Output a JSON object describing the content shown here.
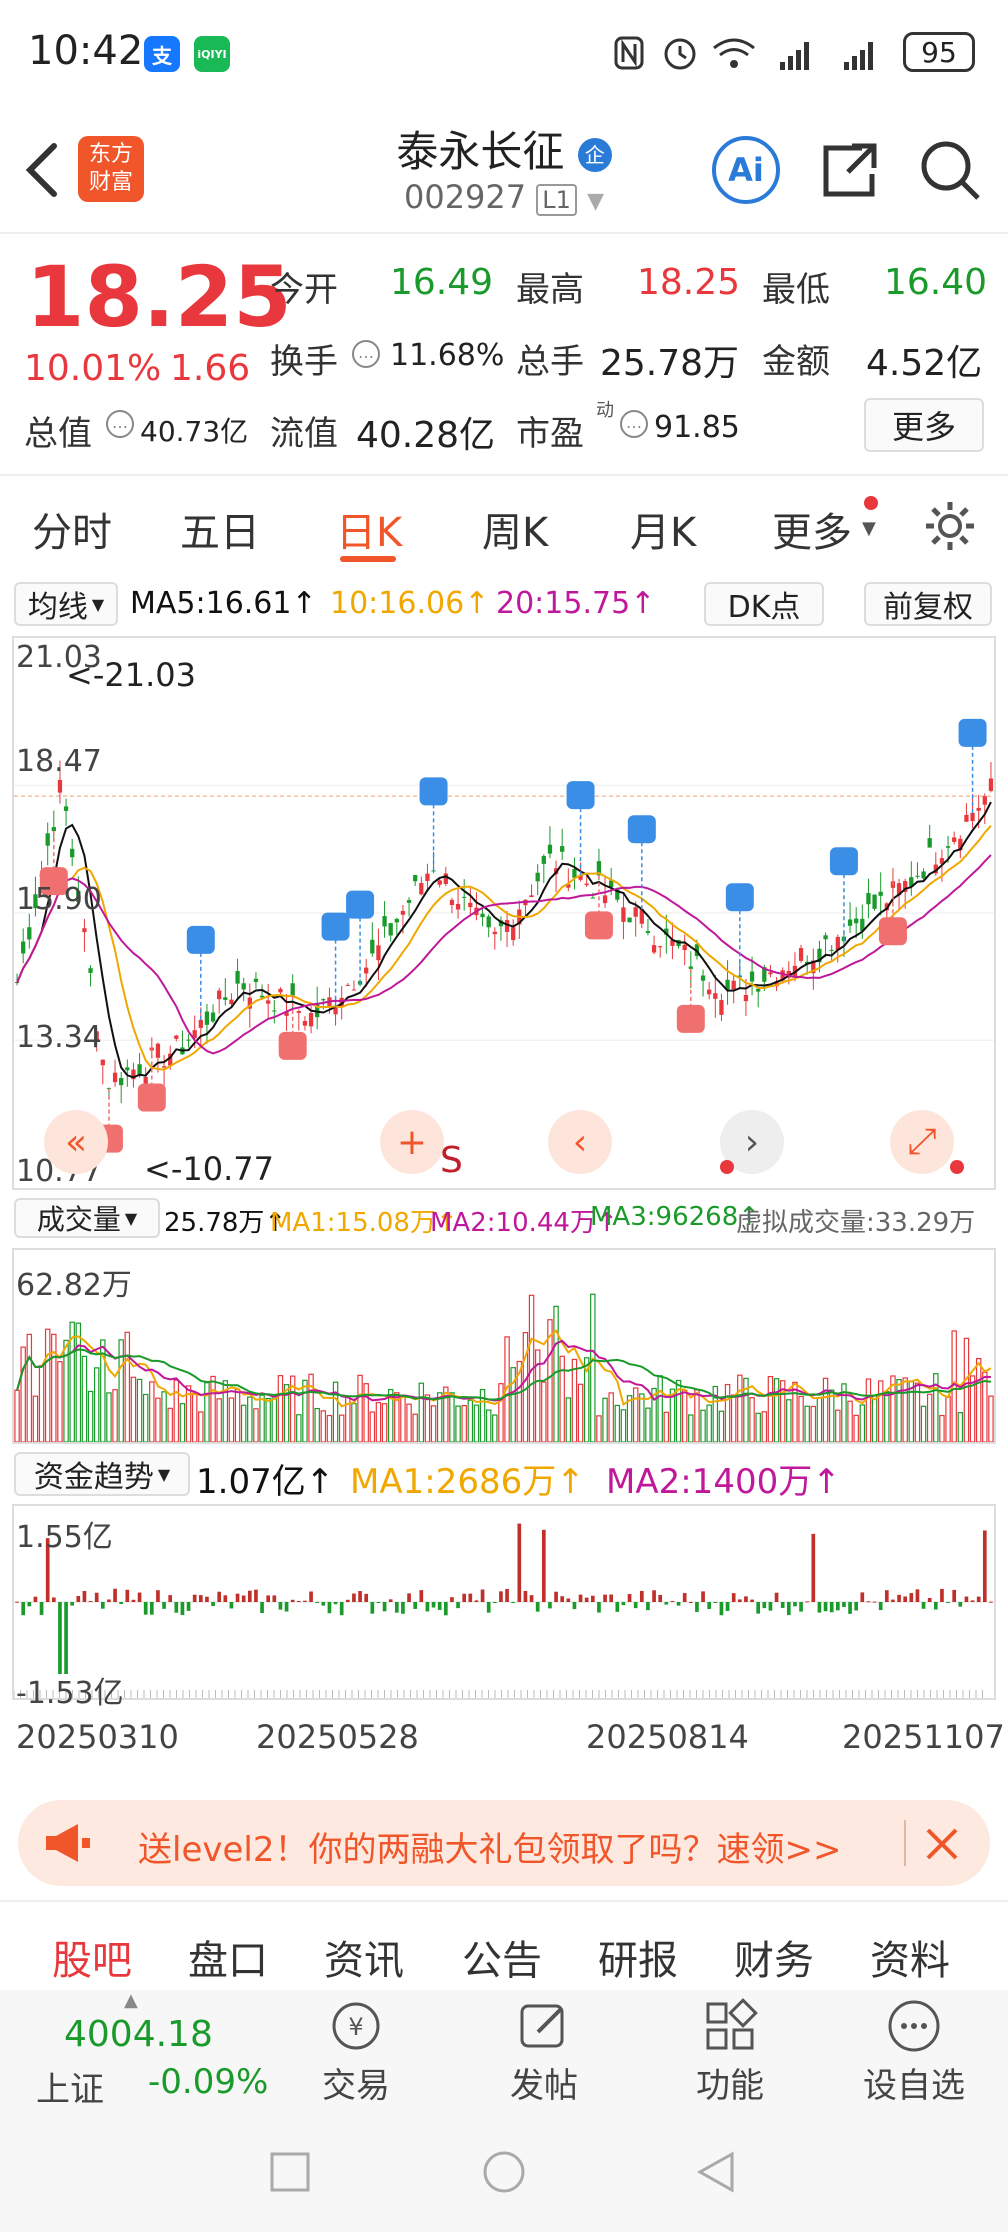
{
  "status": {
    "time": "10:42",
    "battery": "95",
    "app_icon_1": "支",
    "app_icon_2": "iQIYI"
  },
  "header": {
    "stock_name": "泰永长征",
    "badge": "企",
    "stock_code": "002927",
    "level": "L1",
    "logo_line1": "东方",
    "logo_line2": "财富"
  },
  "quote": {
    "price": "18.25",
    "change_pct": "10.01%",
    "change_amt": "1.66",
    "total_value_label": "总值",
    "total_value": "40.73亿",
    "open_label": "今开",
    "open": "16.49",
    "high_label": "最高",
    "high": "18.25",
    "low_label": "最低",
    "low": "16.40",
    "turnover_label": "换手",
    "turnover": "11.68%",
    "volume_label": "总手",
    "volume": "25.78万",
    "amount_label": "金额",
    "amount": "4.52亿",
    "float_label": "流值",
    "float_value": "40.28亿",
    "pe_label": "市盈",
    "pe_sup": "动",
    "pe": "91.85",
    "more_button": "更多"
  },
  "tabs": [
    "分时",
    "五日",
    "日K",
    "周K",
    "月K",
    "更多"
  ],
  "active_tab": "日K",
  "ma_bar": {
    "selector": "均线",
    "ma5": "MA5:16.61↑",
    "ma10": "10:16.06↑",
    "ma20": "20:15.75↑",
    "dk": "DK点",
    "adjust": "前复权"
  },
  "kline": {
    "y_labels": [
      "21.03",
      "18.47",
      "15.90",
      "13.34",
      "10.77"
    ],
    "max_annotation": "<-21.03",
    "min_annotation": "<-10.77",
    "controls": [
      "«",
      "+",
      "‹",
      "›",
      "⤢"
    ],
    "center_letter": "S"
  },
  "volume_bar": {
    "selector": "成交量",
    "value": "25.78万↑",
    "ma1": "MA1:15.08万↑",
    "ma2": "MA2:10.44万↑",
    "ma3": "MA3:96268↑",
    "virtual": "虚拟成交量:33.29万",
    "max_label": "62.82万"
  },
  "fund_bar": {
    "selector": "资金趋势",
    "value": "1.07亿↑",
    "ma1": "MA1:2686万↑",
    "ma2": "MA2:1400万↑",
    "max_label": "1.55亿",
    "min_label": "-1.53亿"
  },
  "x_dates": [
    "20250310",
    "20250528",
    "20250814",
    "20251107"
  ],
  "banner": {
    "text": "送level2！你的两融大礼包领取了吗？速领>>"
  },
  "bottom_tabs": [
    "股吧",
    "盘口",
    "资讯",
    "公告",
    "研报",
    "财务",
    "资料"
  ],
  "active_bottom_tab": "股吧",
  "nav": {
    "index_value": "4004.18",
    "index_name": "上证",
    "index_change": "-0.09%",
    "trade": "交易",
    "post": "发帖",
    "function": "功能",
    "watchlist": "设自选"
  },
  "colors": {
    "up": "#e8383d",
    "down": "#1a9a2a",
    "accent": "#f0562a",
    "ma5": "#111111",
    "ma10": "#f0a800",
    "ma20": "#c0189a"
  }
}
